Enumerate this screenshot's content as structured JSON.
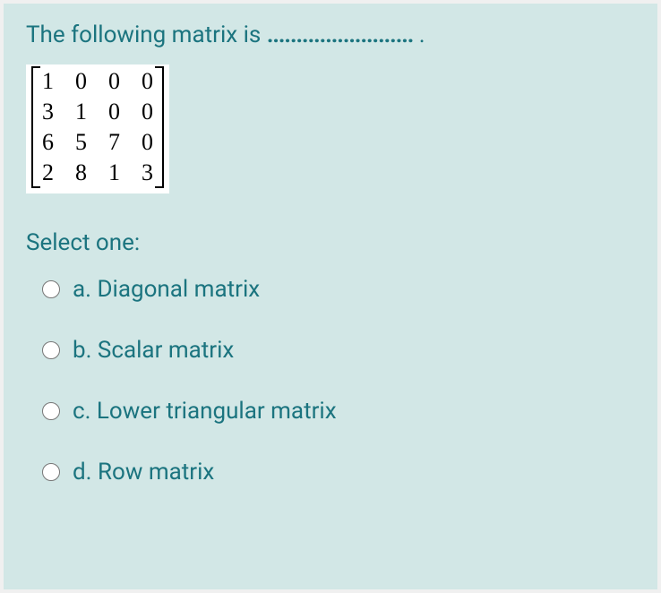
{
  "question": {
    "text_prefix": "The following matrix is ",
    "text_suffix": " ."
  },
  "matrix": {
    "rows": [
      [
        "1",
        "0",
        "0",
        "0"
      ],
      [
        "3",
        "1",
        "0",
        "0"
      ],
      [
        "6",
        "5",
        "7",
        "0"
      ],
      [
        "2",
        "8",
        "1",
        "3"
      ]
    ]
  },
  "select_label": "Select one:",
  "options": [
    {
      "letter": "a.",
      "text": "Diagonal  matrix"
    },
    {
      "letter": "b.",
      "text": "Scalar matrix"
    },
    {
      "letter": "c.",
      "text": "Lower triangular matrix"
    },
    {
      "letter": "d.",
      "text": "Row matrix"
    }
  ]
}
